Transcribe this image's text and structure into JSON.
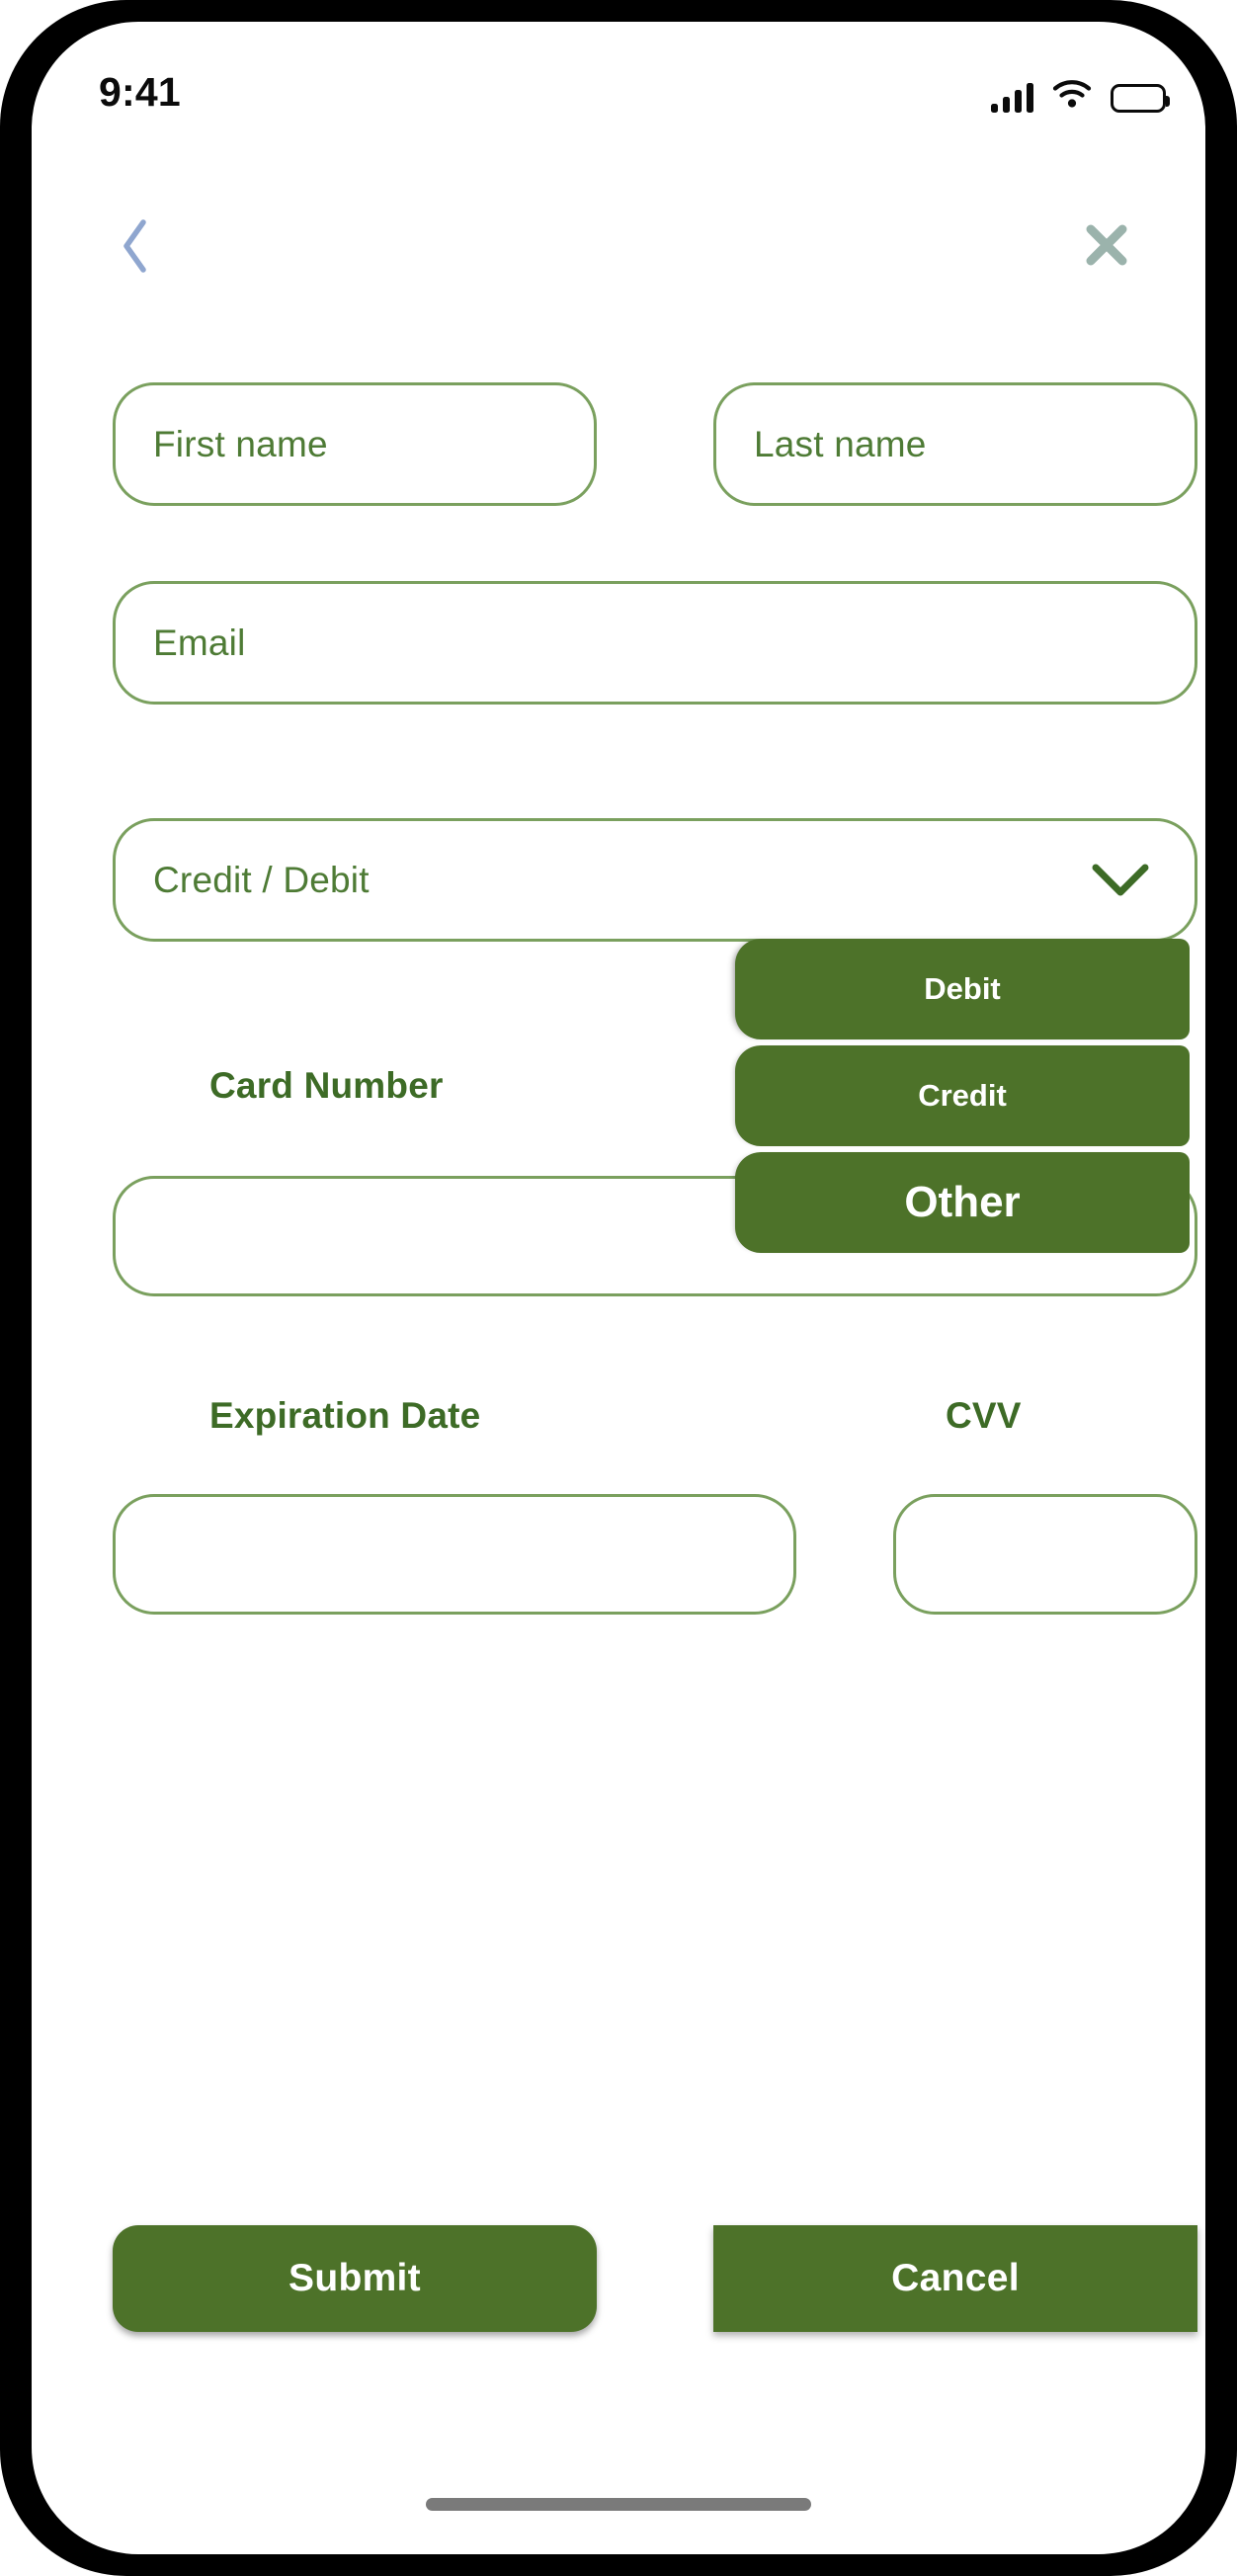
{
  "status_bar": {
    "time": "9:41",
    "signal_icon": "cellular-signal-icon",
    "wifi_icon": "wifi-icon",
    "battery_icon": "battery-full-icon"
  },
  "nav": {
    "back_icon": "chevron-left-icon",
    "close_icon": "close-x-icon",
    "back_color": "#8fa6cf",
    "close_color": "#9bb3ac"
  },
  "theme": {
    "green_fill": "#4d7229",
    "green_text": "#3d6b26",
    "green_border": "#7aa05e",
    "placeholder_green": "#4e7b35",
    "white": "#ffffff"
  },
  "form": {
    "first_name": {
      "placeholder": "First name",
      "value": ""
    },
    "last_name": {
      "placeholder": "Last name",
      "value": ""
    },
    "email": {
      "placeholder": "Email",
      "value": ""
    },
    "card_type": {
      "placeholder": "Credit / Debit",
      "value": "",
      "chevron_icon": "chevron-down-icon",
      "expanded": true,
      "options": [
        "Debit",
        "Credit",
        "Other"
      ]
    },
    "card_number": {
      "label": "Card Number",
      "value": "",
      "placeholder": ""
    },
    "expiration_date": {
      "label": "Expiration Date",
      "value": "",
      "placeholder": ""
    },
    "cvv": {
      "label": "CVV",
      "value": "",
      "placeholder": ""
    }
  },
  "actions": {
    "submit_label": "Submit",
    "cancel_label": "Cancel"
  },
  "home_indicator": "home-indicator"
}
